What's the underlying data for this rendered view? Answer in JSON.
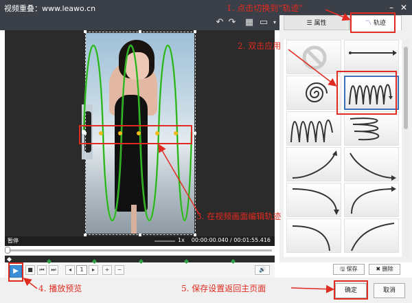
{
  "window": {
    "title": "视频重叠：www.leawo.cn",
    "minimize_icon": "minimize-icon",
    "close_icon": "close-icon"
  },
  "toolbar": {
    "icons": [
      "undo-icon",
      "redo-icon",
      "grid-icon",
      "monitor-icon"
    ]
  },
  "player": {
    "state_label": "暂停",
    "zoom_label": "1x",
    "time_display": "00:00:00.040 / 00:01:55.416",
    "frame_value": "1"
  },
  "panel": {
    "tabs": [
      {
        "label": "属性",
        "icon": "properties-icon",
        "active": false
      },
      {
        "label": "轨迹",
        "icon": "trajectory-icon",
        "active": true
      }
    ],
    "presets": [
      "none-icon",
      "straight-arrow-icon",
      "spiral-icon",
      "loop-wave-icon",
      "zigzag-wave-icon",
      "horizontal-zigzag-icon",
      "arc-up-left-icon",
      "arc-down-right-icon",
      "arc-up-right-icon",
      "curve-spring-icon",
      "curve-down-icon",
      "curve-left-icon",
      "small-arc-icon",
      "diagonal-line-icon"
    ],
    "selected_preset": 3,
    "save_label": "保存",
    "delete_label": "删除"
  },
  "dialog": {
    "ok_label": "确定",
    "cancel_label": "取消"
  },
  "annotations": {
    "step1": "1. 点击切换到“轨迹”",
    "step2": "2. 双击应用",
    "step3": "3. 在视频画面编辑轨迹",
    "step4": "4. 播放预览",
    "step5": "5. 保存设置返回主页面"
  },
  "colors": {
    "annotation": "#e02b20",
    "trajectory": "#3cd12b",
    "point": "#f2b81c",
    "titlebar": "#3b3f47",
    "selection": "#3b6fb6"
  }
}
